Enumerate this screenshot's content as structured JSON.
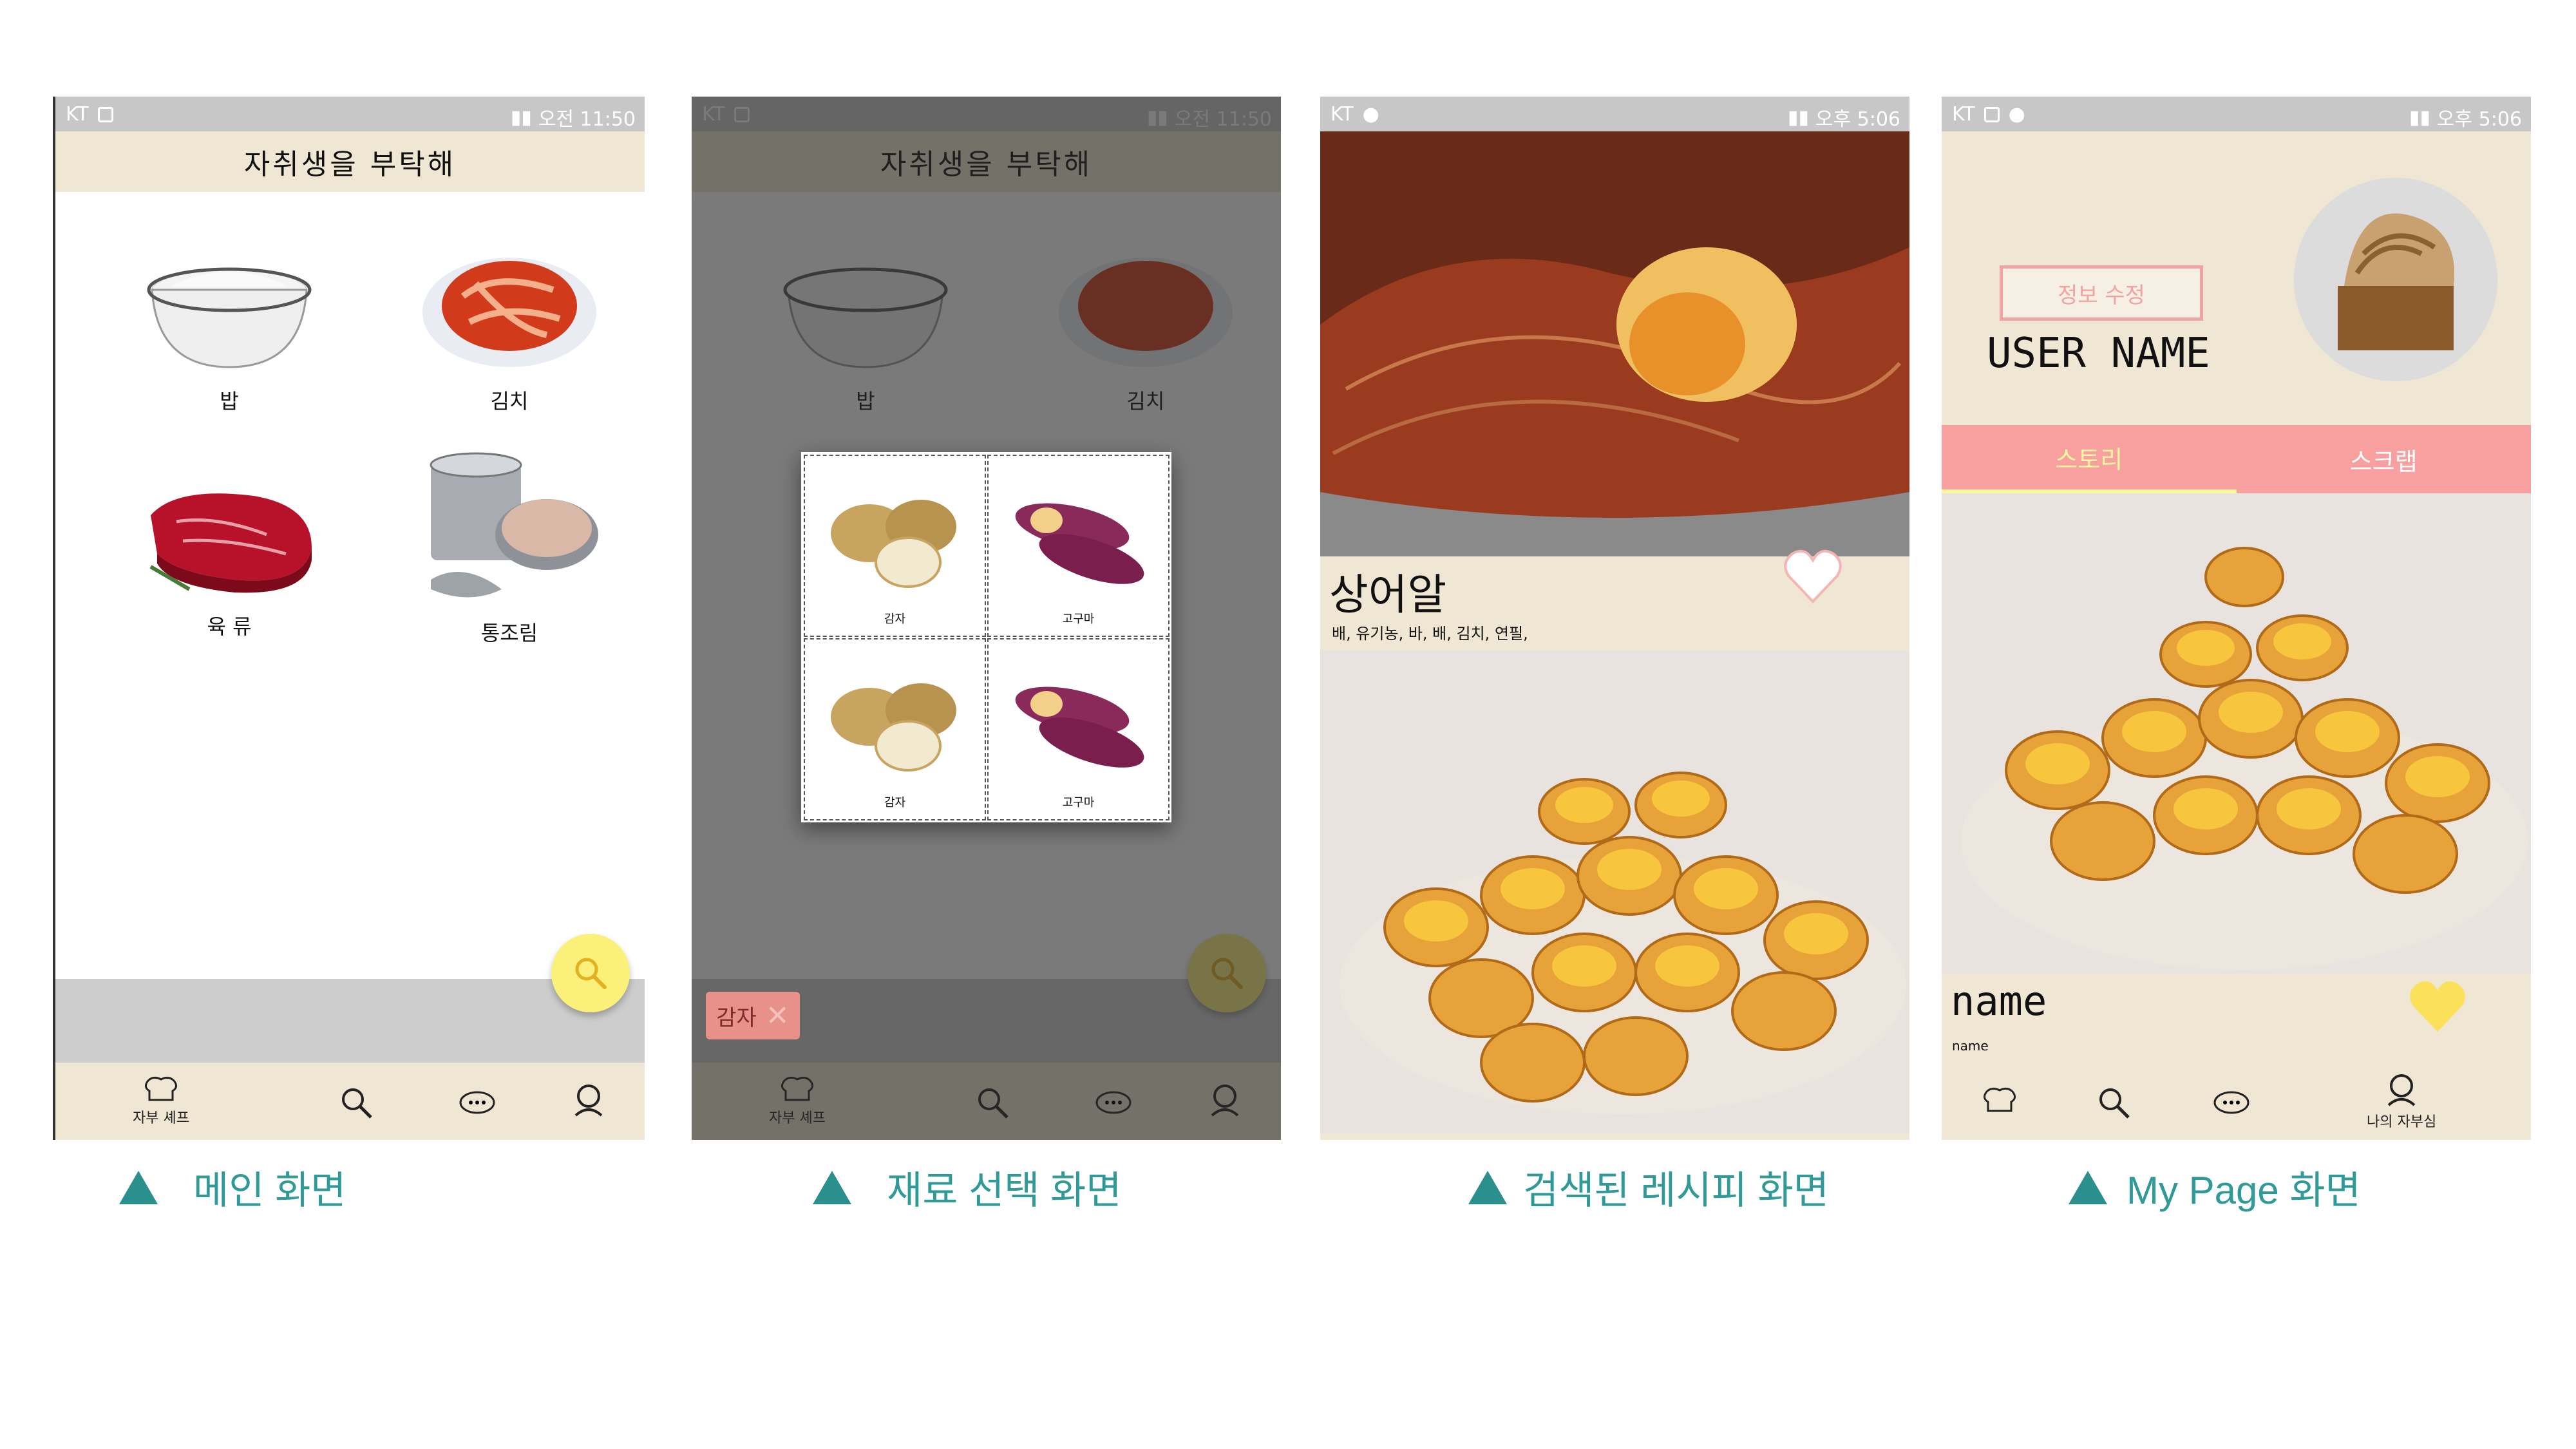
{
  "status": {
    "carrier": "KT",
    "time_am": "오전 11:50",
    "time_pm": "오후 5:06"
  },
  "app": {
    "title": "자취생을 부탁해"
  },
  "main": {
    "items": [
      {
        "label": "밥",
        "icon": "rice-bowl-icon"
      },
      {
        "label": "김치",
        "icon": "kimchi-icon"
      },
      {
        "label": "육 류",
        "icon": "meat-icon"
      },
      {
        "label": "통조림",
        "icon": "canned-food-icon"
      }
    ]
  },
  "nav": {
    "chef_label": "자부 셰프",
    "mypage_label": "나의 자부심"
  },
  "select": {
    "items": [
      {
        "label": "감자"
      },
      {
        "label": "고구마"
      },
      {
        "label": "감자"
      },
      {
        "label": "고구마"
      }
    ],
    "chip_label": "감자"
  },
  "recipe": {
    "name": "상어알",
    "ingredients": "배, 유기농, 바, 배, 김치, 연필,"
  },
  "mypage": {
    "edit_button": "정보 수정",
    "username": "USER NAME",
    "tabs": [
      "스토리",
      "스크랩"
    ],
    "post_title": "name",
    "post_sub": "name"
  },
  "captions": [
    "메인 화면",
    "재료 선택 화면",
    "검색된 레시피 화면",
    "My Page 화면"
  ],
  "colors": {
    "beige": "#efe6d3",
    "fab_yellow": "#fbf07a",
    "pink_tab": "#f8a0a0",
    "caption_teal": "#2f9a98"
  }
}
